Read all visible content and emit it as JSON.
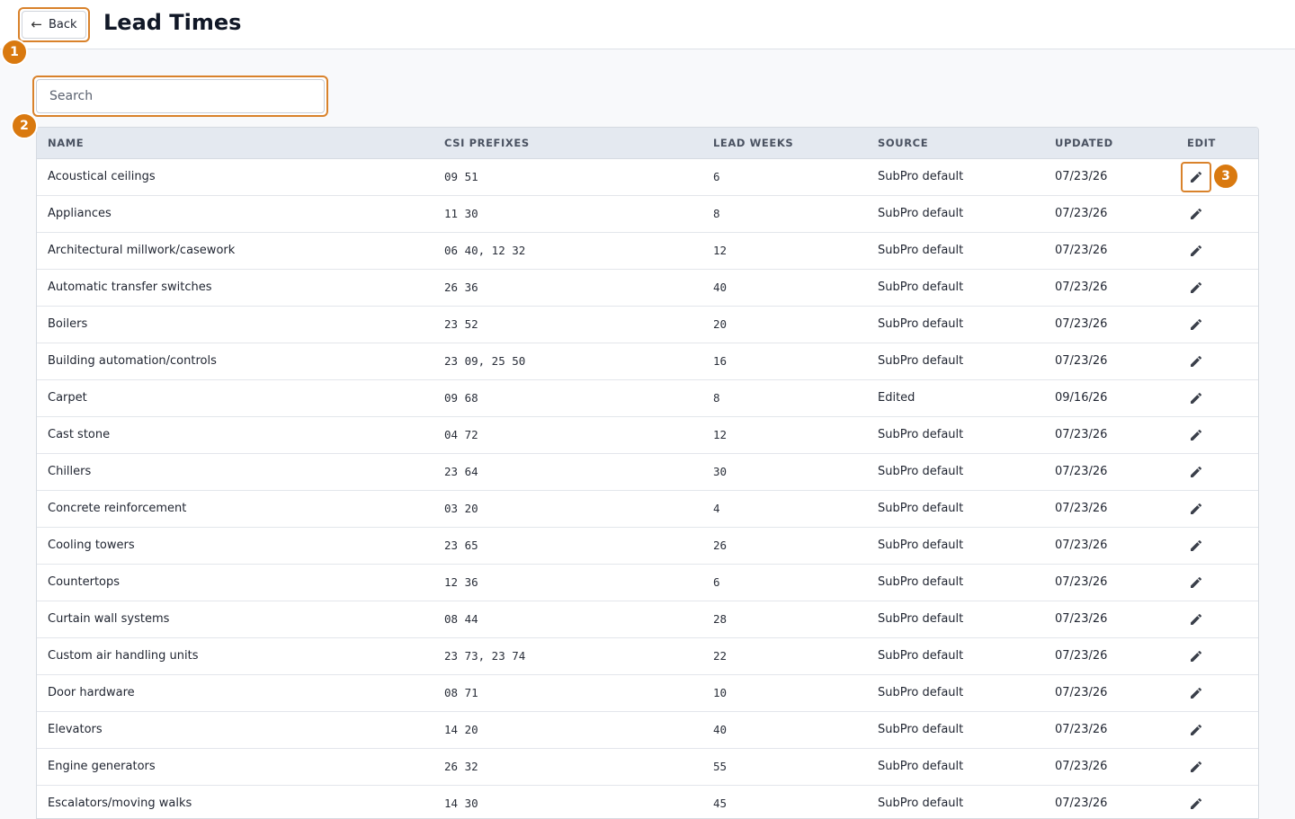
{
  "header": {
    "back_label": "Back",
    "title": "Lead Times"
  },
  "badges": [
    "1",
    "2",
    "3"
  ],
  "search": {
    "placeholder": "Search",
    "value": ""
  },
  "table": {
    "columns": [
      "NAME",
      "CSI PREFIXES",
      "LEAD WEEKS",
      "SOURCE",
      "UPDATED",
      "EDIT"
    ],
    "rows": [
      {
        "name": "Acoustical ceilings",
        "csi": "09 51",
        "weeks": "6",
        "source": "SubPro default",
        "updated": "07/23/26"
      },
      {
        "name": "Appliances",
        "csi": "11 30",
        "weeks": "8",
        "source": "SubPro default",
        "updated": "07/23/26"
      },
      {
        "name": "Architectural millwork/casework",
        "csi": "06 40, 12 32",
        "weeks": "12",
        "source": "SubPro default",
        "updated": "07/23/26"
      },
      {
        "name": "Automatic transfer switches",
        "csi": "26 36",
        "weeks": "40",
        "source": "SubPro default",
        "updated": "07/23/26"
      },
      {
        "name": "Boilers",
        "csi": "23 52",
        "weeks": "20",
        "source": "SubPro default",
        "updated": "07/23/26"
      },
      {
        "name": "Building automation/controls",
        "csi": "23 09, 25 50",
        "weeks": "16",
        "source": "SubPro default",
        "updated": "07/23/26"
      },
      {
        "name": "Carpet",
        "csi": "09 68",
        "weeks": "8",
        "source": "Edited",
        "updated": "09/16/26"
      },
      {
        "name": "Cast stone",
        "csi": "04 72",
        "weeks": "12",
        "source": "SubPro default",
        "updated": "07/23/26"
      },
      {
        "name": "Chillers",
        "csi": "23 64",
        "weeks": "30",
        "source": "SubPro default",
        "updated": "07/23/26"
      },
      {
        "name": "Concrete reinforcement",
        "csi": "03 20",
        "weeks": "4",
        "source": "SubPro default",
        "updated": "07/23/26"
      },
      {
        "name": "Cooling towers",
        "csi": "23 65",
        "weeks": "26",
        "source": "SubPro default",
        "updated": "07/23/26"
      },
      {
        "name": "Countertops",
        "csi": "12 36",
        "weeks": "6",
        "source": "SubPro default",
        "updated": "07/23/26"
      },
      {
        "name": "Curtain wall systems",
        "csi": "08 44",
        "weeks": "28",
        "source": "SubPro default",
        "updated": "07/23/26"
      },
      {
        "name": "Custom air handling units",
        "csi": "23 73, 23 74",
        "weeks": "22",
        "source": "SubPro default",
        "updated": "07/23/26"
      },
      {
        "name": "Door hardware",
        "csi": "08 71",
        "weeks": "10",
        "source": "SubPro default",
        "updated": "07/23/26"
      },
      {
        "name": "Elevators",
        "csi": "14 20",
        "weeks": "40",
        "source": "SubPro default",
        "updated": "07/23/26"
      },
      {
        "name": "Engine generators",
        "csi": "26 32",
        "weeks": "55",
        "source": "SubPro default",
        "updated": "07/23/26"
      },
      {
        "name": "Escalators/moving walks",
        "csi": "14 30",
        "weeks": "45",
        "source": "SubPro default",
        "updated": "07/23/26"
      }
    ]
  },
  "colors": {
    "accent": "#d9822b",
    "badge": "#d9790f",
    "header_bg": "#e4e9f0"
  },
  "icons": {
    "back": "arrow-left-icon",
    "edit": "pencil-icon"
  }
}
